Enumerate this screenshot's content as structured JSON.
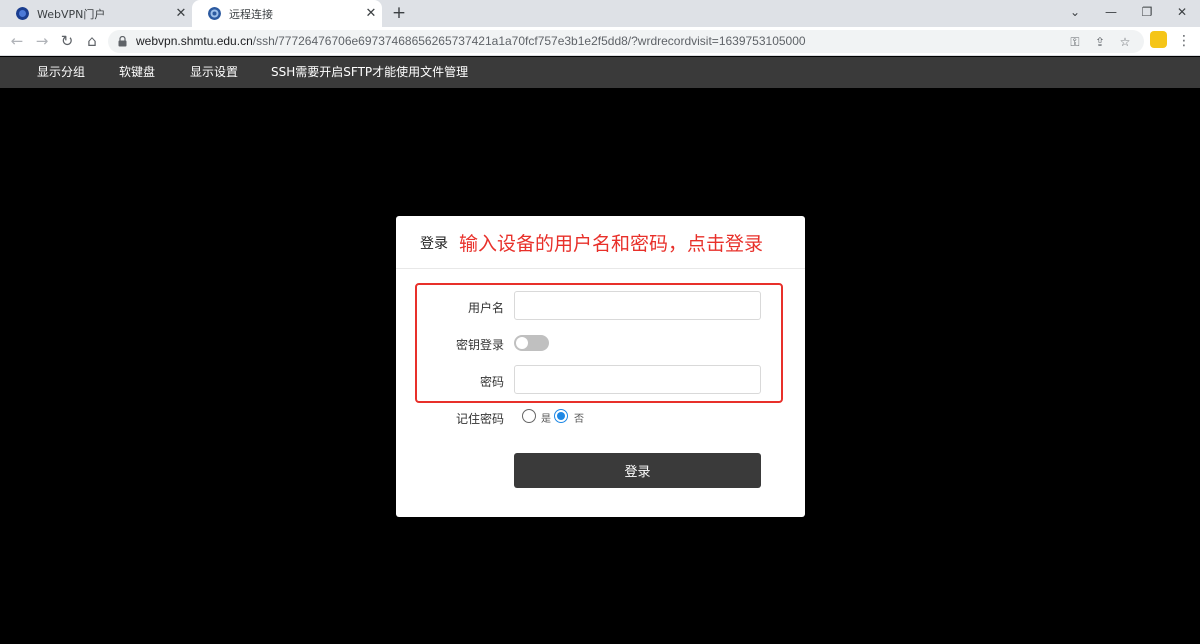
{
  "browser": {
    "tabs": [
      {
        "title": "WebVPN门户",
        "active": false
      },
      {
        "title": "远程连接",
        "active": true
      }
    ],
    "url_host": "webvpn.shmtu.edu.cn",
    "url_path": "/ssh/77726476706e69737468656265737421a1a70fcf757e3b1e2f5dd8/?wrdrecordvisit=1639753105000"
  },
  "menubar": {
    "items": [
      "显示分组",
      "软键盘",
      "显示设置",
      "SSH需要开启SFTP才能使用文件管理"
    ]
  },
  "dialog": {
    "title": "登录",
    "annotation": "输入设备的用户名和密码，点击登录",
    "username_label": "用户名",
    "username_value": "",
    "key_login_label": "密钥登录",
    "key_login_enabled": false,
    "password_label": "密码",
    "password_value": "",
    "remember_label": "记住密码",
    "remember_yes": "是",
    "remember_no": "否",
    "remember_selected": "否",
    "submit_label": "登录"
  },
  "colors": {
    "annotation": "#e8302a",
    "menubar_bg": "#3a3a3a",
    "radio_accent": "#1e88e5"
  }
}
